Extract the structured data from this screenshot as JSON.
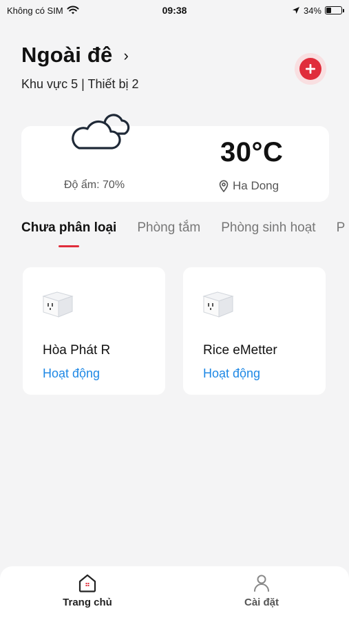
{
  "status_bar": {
    "carrier": "Không có SIM",
    "time": "09:38",
    "battery": "34%",
    "battery_level": 0.34
  },
  "home": {
    "title": "Ngoài đê",
    "chevron": "›",
    "subtitle": "Khu vực 5 | Thiết bị 2",
    "add_icon": "plus-icon",
    "accent_color": "#e02d3b"
  },
  "weather": {
    "icon": "cloud-icon",
    "humidity": "Độ ẩm: 70%",
    "temperature": "30°C",
    "location": "Ha Dong"
  },
  "tabs": [
    {
      "label": "Chưa phân loại",
      "active": true
    },
    {
      "label": "Phòng tắm",
      "active": false
    },
    {
      "label": "Phòng sinh hoạt",
      "active": false
    },
    {
      "label": "P",
      "active": false
    }
  ],
  "devices": [
    {
      "name": "Hòa Phát R",
      "status": "Hoạt động",
      "icon": "smart-plug-icon"
    },
    {
      "name": "Rice eMetter",
      "status": "Hoạt động",
      "icon": "smart-plug-icon"
    }
  ],
  "bottom_nav": [
    {
      "label": "Trang chủ",
      "icon": "home-icon",
      "active": true
    },
    {
      "label": "Cài đặt",
      "icon": "user-icon",
      "active": false
    }
  ],
  "status_color": "#1e88e5"
}
